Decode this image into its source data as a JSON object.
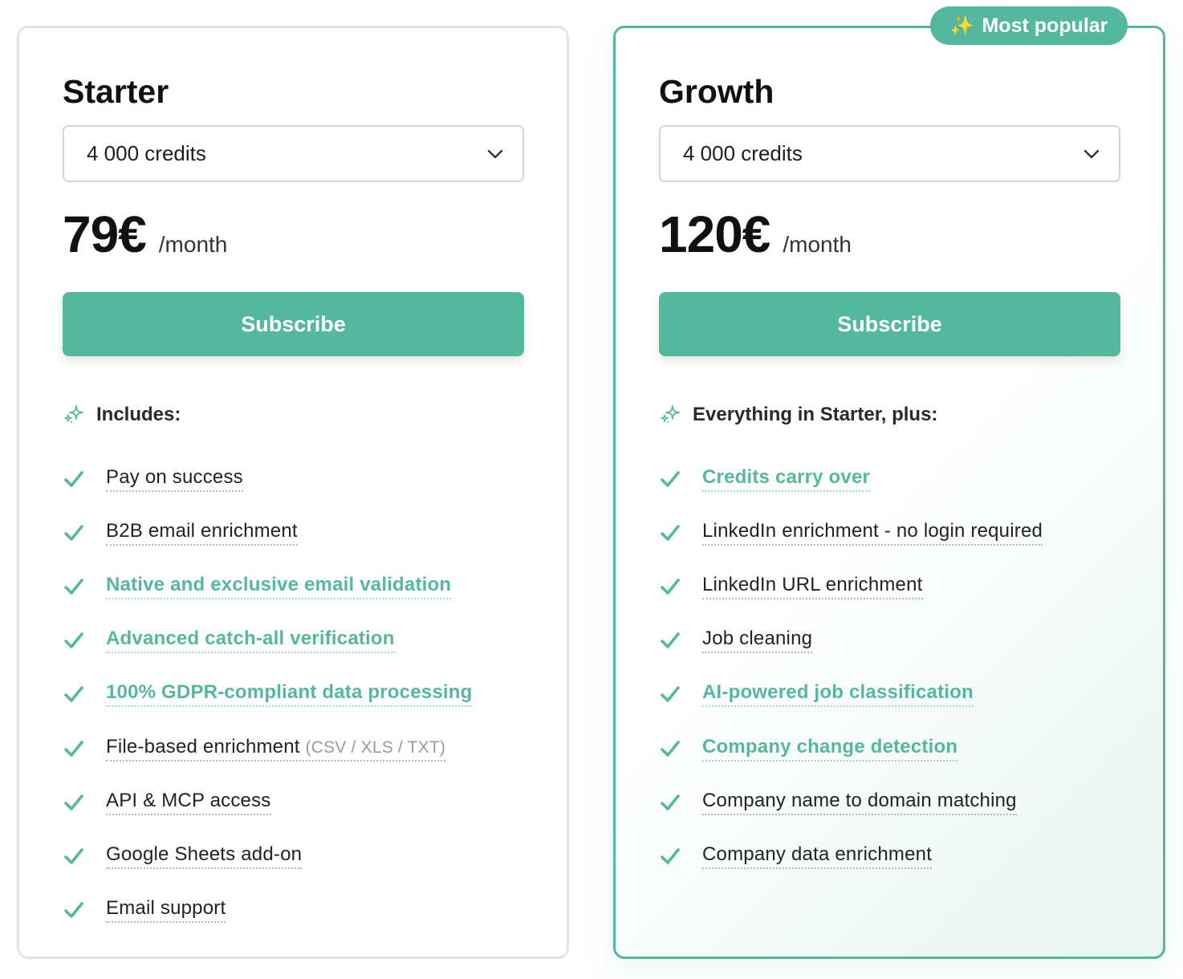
{
  "colors": {
    "accent": "#54b89f",
    "badge_text": "#ffffff",
    "card_border": "#e4e4e4"
  },
  "plans": [
    {
      "name": "Starter",
      "credits_selected": "4 000 credits",
      "price": "79€",
      "period": "/month",
      "cta": "Subscribe",
      "includes_label": "Includes:",
      "features": [
        {
          "text": "Pay on success",
          "accent": false
        },
        {
          "text": "B2B email enrichment",
          "accent": false
        },
        {
          "text": "Native and exclusive email validation",
          "accent": true
        },
        {
          "text": "Advanced catch-all verification",
          "accent": true
        },
        {
          "text": "100% GDPR-compliant data processing",
          "accent": true
        },
        {
          "text": "File-based enrichment",
          "note": "(CSV / XLS / TXT)",
          "accent": false
        },
        {
          "text": "API & MCP access",
          "accent": false
        },
        {
          "text": "Google Sheets add-on",
          "accent": false
        },
        {
          "text": "Email support",
          "accent": false
        }
      ]
    },
    {
      "name": "Growth",
      "badge": "Most popular",
      "badge_icon": "sparkles-icon",
      "credits_selected": "4 000 credits",
      "price": "120€",
      "period": "/month",
      "cta": "Subscribe",
      "includes_label": "Everything in Starter, plus:",
      "features": [
        {
          "text": "Credits carry over",
          "accent": true
        },
        {
          "text": "LinkedIn enrichment - no login required",
          "accent": false
        },
        {
          "text": "LinkedIn URL enrichment",
          "accent": false
        },
        {
          "text": "Job cleaning",
          "accent": false
        },
        {
          "text": "AI-powered job classification",
          "accent": true
        },
        {
          "text": "Company change detection",
          "accent": true
        },
        {
          "text": "Company name to domain matching",
          "accent": false
        },
        {
          "text": "Company data enrichment",
          "accent": false
        }
      ]
    }
  ]
}
